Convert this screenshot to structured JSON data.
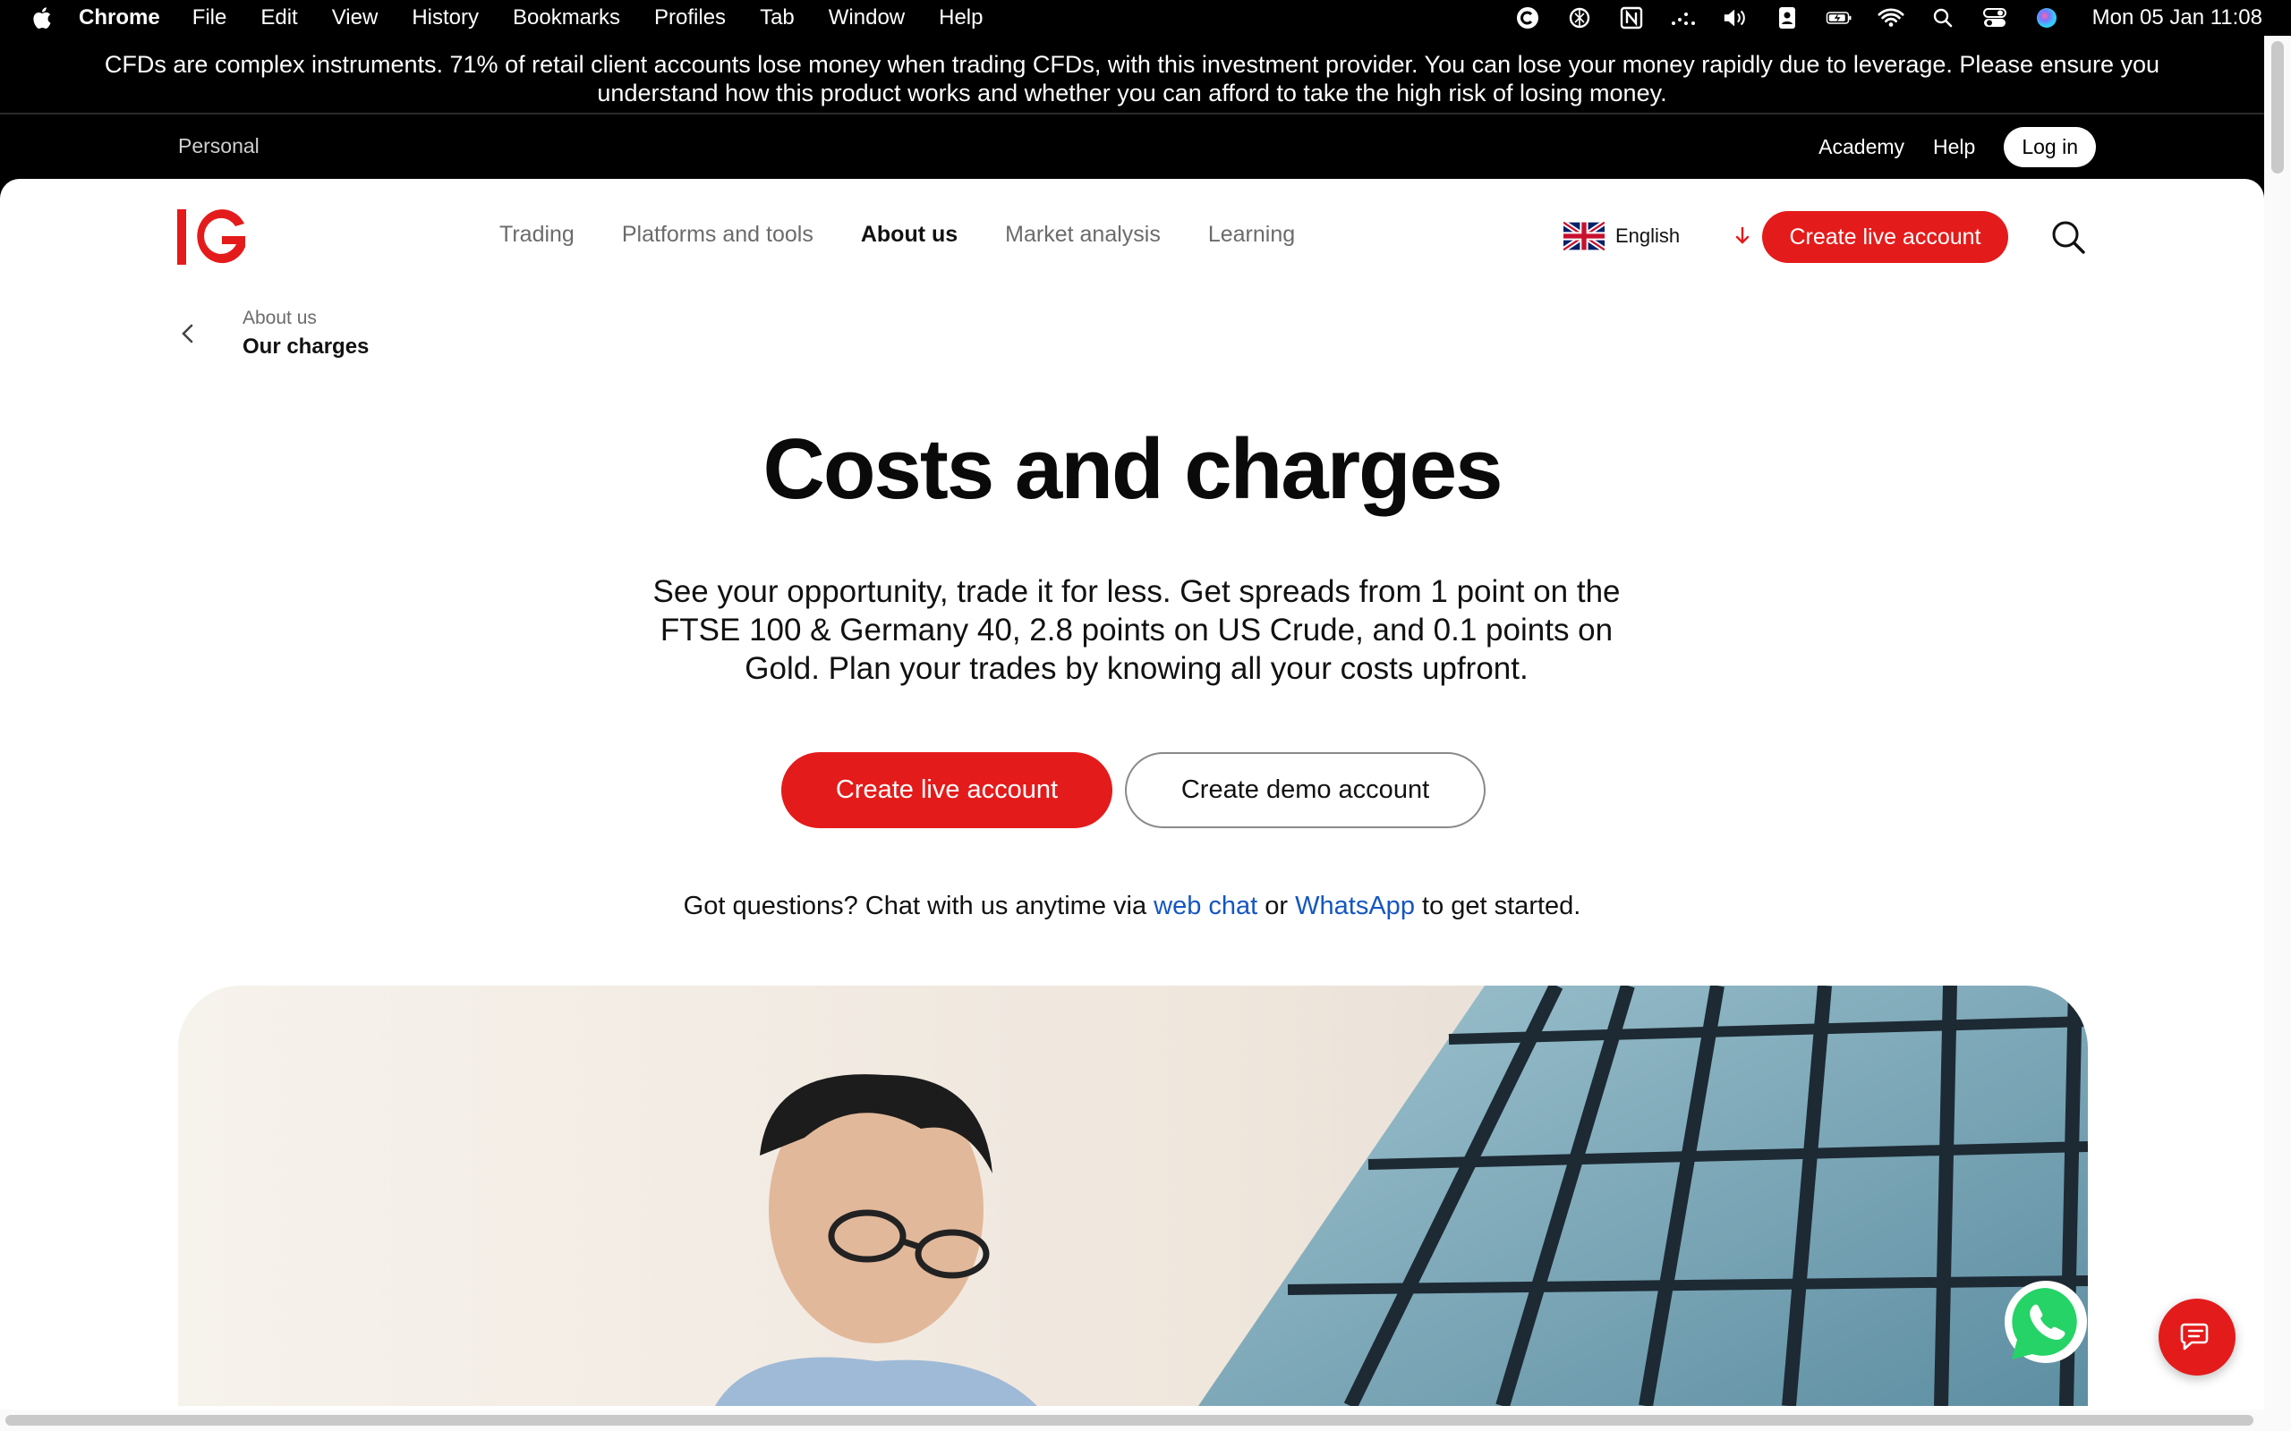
{
  "menubar": {
    "app_name": "Chrome",
    "items": [
      "File",
      "Edit",
      "View",
      "History",
      "Bookmarks",
      "Profiles",
      "Tab",
      "Window",
      "Help"
    ],
    "clock": "Mon 05 Jan  11:08"
  },
  "risk_warning": "CFDs are complex instruments. 71% of retail client accounts lose money when trading CFDs, with this investment provider. You can lose your money rapidly due to leverage. Please ensure you understand how this product works and whether you can afford to take the high risk of losing money.",
  "subnav": {
    "segment": "Personal",
    "academy": "Academy",
    "help": "Help",
    "login": "Log in"
  },
  "nav": {
    "links": [
      "Trading",
      "Platforms and tools",
      "About us",
      "Market analysis",
      "Learning"
    ],
    "active": "About us",
    "language": "English",
    "cta": "Create live account"
  },
  "breadcrumb": {
    "parent": "About us",
    "current": "Our charges"
  },
  "hero": {
    "title": "Costs and charges",
    "subtitle": "See your opportunity, trade it for less. Get spreads from 1 point on the FTSE 100 & Germany 40, 2.8 points on US Crude, and 0.1 points on Gold. Plan your trades by knowing all your costs upfront.",
    "primary_button": "Create live account",
    "secondary_button": "Create demo account",
    "chat_prefix": "Got questions? Chat with us anytime via",
    "chat_link_web": "web chat",
    "chat_or": "or",
    "chat_link_whatsapp": "WhatsApp",
    "chat_suffix": "to get started."
  },
  "colors": {
    "brand_red": "#e41b1b",
    "link_blue": "#1556c0"
  }
}
